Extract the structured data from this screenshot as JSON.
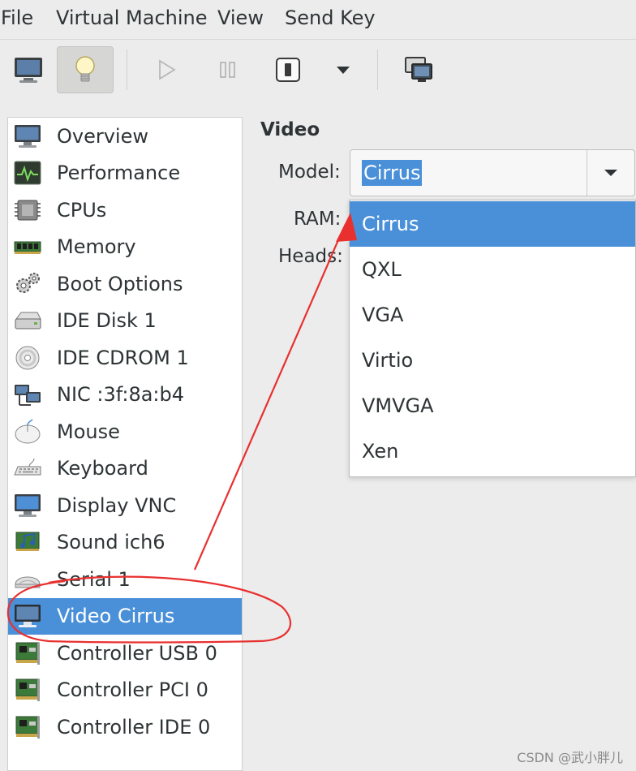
{
  "menubar": {
    "items": [
      "File",
      "Virtual Machine",
      "View",
      "Send Key"
    ]
  },
  "toolbar": {
    "buttons": [
      "console-icon",
      "details-lightbulb-icon",
      "run-icon",
      "pause-icon",
      "shutdown-icon",
      "shutdown-menu-chevron-icon",
      "fullscreen-icon"
    ],
    "active": "details-lightbulb-icon"
  },
  "sidebar": {
    "items": [
      {
        "label": "Overview",
        "icon": "monitor-icon"
      },
      {
        "label": "Performance",
        "icon": "performance-chart-icon"
      },
      {
        "label": "CPUs",
        "icon": "cpu-chip-icon"
      },
      {
        "label": "Memory",
        "icon": "memory-stick-icon"
      },
      {
        "label": "Boot Options",
        "icon": "gears-icon"
      },
      {
        "label": "IDE Disk 1",
        "icon": "hard-disk-icon"
      },
      {
        "label": "IDE CDROM 1",
        "icon": "cdrom-icon"
      },
      {
        "label": "NIC :3f:8a:b4",
        "icon": "network-icon"
      },
      {
        "label": "Mouse",
        "icon": "mouse-icon"
      },
      {
        "label": "Keyboard",
        "icon": "keyboard-icon"
      },
      {
        "label": "Display VNC",
        "icon": "display-icon"
      },
      {
        "label": "Sound ich6",
        "icon": "sound-card-icon"
      },
      {
        "label": "Serial 1",
        "icon": "serial-port-icon"
      },
      {
        "label": "Video Cirrus",
        "icon": "video-monitor-icon"
      },
      {
        "label": "Controller USB 0",
        "icon": "controller-card-icon"
      },
      {
        "label": "Controller PCI 0",
        "icon": "controller-card-icon"
      },
      {
        "label": "Controller IDE 0",
        "icon": "controller-card-icon"
      }
    ],
    "selected": "Video Cirrus"
  },
  "detail": {
    "section_title": "Video",
    "model_label": "Model:",
    "ram_label": "RAM:",
    "heads_label": "Heads:",
    "model_value": "Cirrus",
    "model_options": [
      "Cirrus",
      "QXL",
      "VGA",
      "Virtio",
      "VMVGA",
      "Xen"
    ],
    "highlighted_option": "Cirrus"
  },
  "colors": {
    "selection": "#4a90d9",
    "annotation": "#e8302f"
  },
  "watermark": "CSDN @武小胖儿"
}
